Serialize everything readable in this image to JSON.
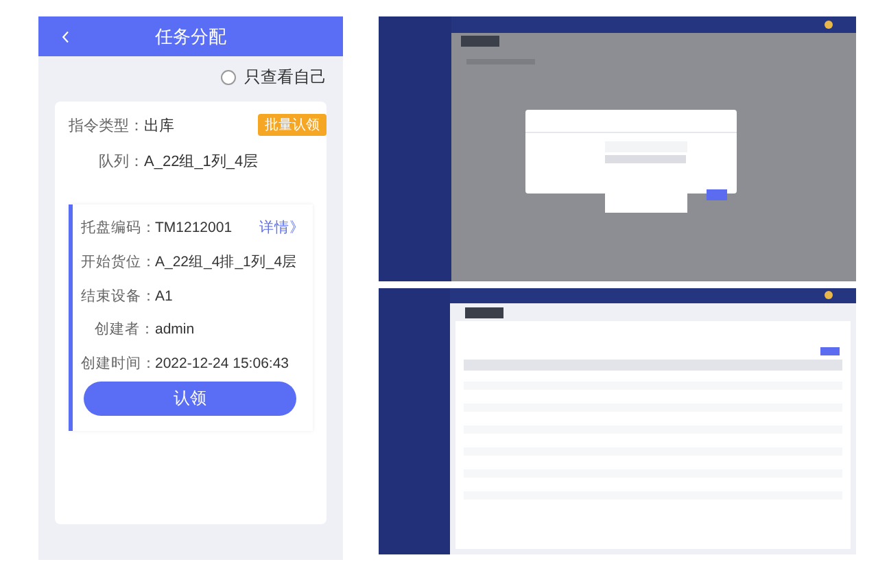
{
  "header": {
    "title": "任务分配"
  },
  "filter": {
    "label": "只查看自己",
    "checked": false
  },
  "group": {
    "fields": [
      {
        "label": "指令类型：",
        "value": "出库"
      },
      {
        "label": "队列：",
        "value": "A_22组_1列_4层"
      }
    ],
    "batch_button": "批量认领",
    "tasks": [
      {
        "fields": [
          {
            "label": "托盘编码：",
            "value": "TM1212001"
          },
          {
            "label": "开始货位：",
            "value": "A_22组_4排_1列_4层"
          },
          {
            "label": "结束设备：",
            "value": "A1"
          },
          {
            "label": "创建者：",
            "value": "admin"
          },
          {
            "label": "创建时间：",
            "value": "2022-12-24 15:06:43"
          }
        ],
        "detail_link": "详情》",
        "claim_button": "认领"
      }
    ]
  }
}
